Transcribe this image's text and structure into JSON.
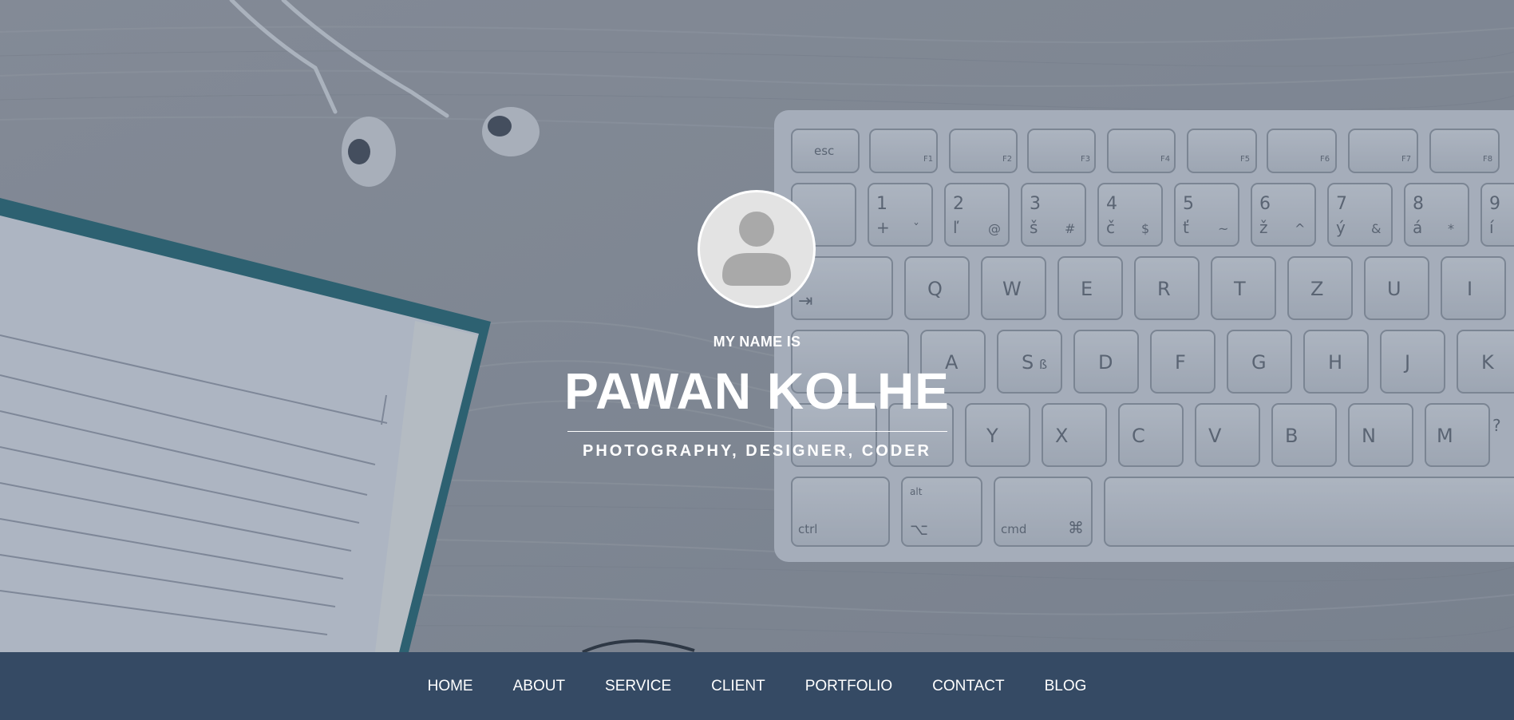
{
  "profile": {
    "intro": "MY NAME IS",
    "name": "PAWAN KOLHE",
    "tagline": "PHOTOGRAPHY, DESIGNER, CODER"
  },
  "nav": {
    "items": [
      {
        "label": "HOME"
      },
      {
        "label": "ABOUT"
      },
      {
        "label": "SERVICE"
      },
      {
        "label": "CLIENT"
      },
      {
        "label": "PORTFOLIO"
      },
      {
        "label": "CONTACT"
      },
      {
        "label": "BLOG"
      }
    ]
  },
  "hero": {
    "keyboard_labels": {
      "esc": "esc",
      "ctrl": "ctrl",
      "alt": "alt",
      "cmd": "cmd",
      "f1": "F1",
      "f2": "F2",
      "f3": "F3",
      "f4": "F4",
      "f5": "F5",
      "f6": "F6",
      "f7": "F7",
      "f8": "F8",
      "row1": [
        "1",
        "2",
        "3",
        "4",
        "5",
        "6",
        "7",
        "8",
        "9"
      ],
      "row1_sub": [
        "+",
        "ľ",
        "š",
        "č",
        "ť",
        "ž",
        "ý",
        "á",
        "í"
      ],
      "row1_sym": [
        "ˇ",
        "@",
        "#",
        "$",
        "~",
        "^",
        "&",
        "*",
        ""
      ],
      "row2": [
        "Q",
        "W",
        "E",
        "R",
        "T",
        "Z",
        "U",
        "I"
      ],
      "row3": [
        "A",
        "S",
        "D",
        "F",
        "G",
        "H",
        "J",
        "K"
      ],
      "row3_alt": "ß",
      "row4": [
        "Y",
        "X",
        "C",
        "V",
        "B",
        "N",
        "M"
      ],
      "row4_extra": "?",
      "symbol_cmd": "⌘",
      "symbol_alt": "⌥",
      "symbol_tab": "⇥"
    }
  },
  "colors": {
    "navbar": "#354a64",
    "overlay": "#2c3e58",
    "text": "#ffffff"
  }
}
